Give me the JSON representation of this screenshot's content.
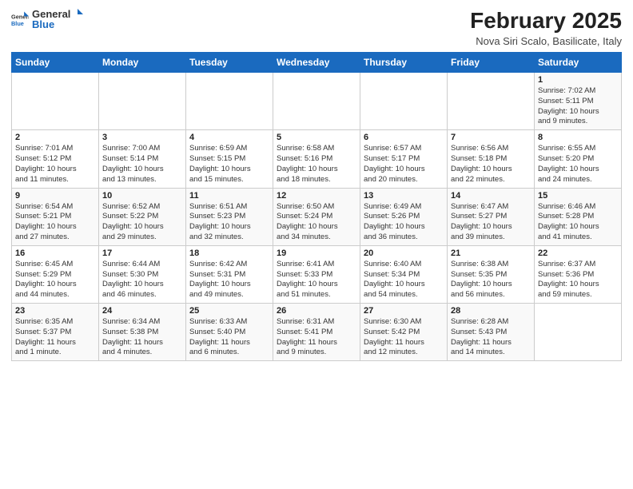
{
  "header": {
    "logo_general": "General",
    "logo_blue": "Blue",
    "title": "February 2025",
    "location": "Nova Siri Scalo, Basilicate, Italy"
  },
  "days_of_week": [
    "Sunday",
    "Monday",
    "Tuesday",
    "Wednesday",
    "Thursday",
    "Friday",
    "Saturday"
  ],
  "weeks": [
    [
      {
        "day": "",
        "info": ""
      },
      {
        "day": "",
        "info": ""
      },
      {
        "day": "",
        "info": ""
      },
      {
        "day": "",
        "info": ""
      },
      {
        "day": "",
        "info": ""
      },
      {
        "day": "",
        "info": ""
      },
      {
        "day": "1",
        "info": "Sunrise: 7:02 AM\nSunset: 5:11 PM\nDaylight: 10 hours\nand 9 minutes."
      }
    ],
    [
      {
        "day": "2",
        "info": "Sunrise: 7:01 AM\nSunset: 5:12 PM\nDaylight: 10 hours\nand 11 minutes."
      },
      {
        "day": "3",
        "info": "Sunrise: 7:00 AM\nSunset: 5:14 PM\nDaylight: 10 hours\nand 13 minutes."
      },
      {
        "day": "4",
        "info": "Sunrise: 6:59 AM\nSunset: 5:15 PM\nDaylight: 10 hours\nand 15 minutes."
      },
      {
        "day": "5",
        "info": "Sunrise: 6:58 AM\nSunset: 5:16 PM\nDaylight: 10 hours\nand 18 minutes."
      },
      {
        "day": "6",
        "info": "Sunrise: 6:57 AM\nSunset: 5:17 PM\nDaylight: 10 hours\nand 20 minutes."
      },
      {
        "day": "7",
        "info": "Sunrise: 6:56 AM\nSunset: 5:18 PM\nDaylight: 10 hours\nand 22 minutes."
      },
      {
        "day": "8",
        "info": "Sunrise: 6:55 AM\nSunset: 5:20 PM\nDaylight: 10 hours\nand 24 minutes."
      }
    ],
    [
      {
        "day": "9",
        "info": "Sunrise: 6:54 AM\nSunset: 5:21 PM\nDaylight: 10 hours\nand 27 minutes."
      },
      {
        "day": "10",
        "info": "Sunrise: 6:52 AM\nSunset: 5:22 PM\nDaylight: 10 hours\nand 29 minutes."
      },
      {
        "day": "11",
        "info": "Sunrise: 6:51 AM\nSunset: 5:23 PM\nDaylight: 10 hours\nand 32 minutes."
      },
      {
        "day": "12",
        "info": "Sunrise: 6:50 AM\nSunset: 5:24 PM\nDaylight: 10 hours\nand 34 minutes."
      },
      {
        "day": "13",
        "info": "Sunrise: 6:49 AM\nSunset: 5:26 PM\nDaylight: 10 hours\nand 36 minutes."
      },
      {
        "day": "14",
        "info": "Sunrise: 6:47 AM\nSunset: 5:27 PM\nDaylight: 10 hours\nand 39 minutes."
      },
      {
        "day": "15",
        "info": "Sunrise: 6:46 AM\nSunset: 5:28 PM\nDaylight: 10 hours\nand 41 minutes."
      }
    ],
    [
      {
        "day": "16",
        "info": "Sunrise: 6:45 AM\nSunset: 5:29 PM\nDaylight: 10 hours\nand 44 minutes."
      },
      {
        "day": "17",
        "info": "Sunrise: 6:44 AM\nSunset: 5:30 PM\nDaylight: 10 hours\nand 46 minutes."
      },
      {
        "day": "18",
        "info": "Sunrise: 6:42 AM\nSunset: 5:31 PM\nDaylight: 10 hours\nand 49 minutes."
      },
      {
        "day": "19",
        "info": "Sunrise: 6:41 AM\nSunset: 5:33 PM\nDaylight: 10 hours\nand 51 minutes."
      },
      {
        "day": "20",
        "info": "Sunrise: 6:40 AM\nSunset: 5:34 PM\nDaylight: 10 hours\nand 54 minutes."
      },
      {
        "day": "21",
        "info": "Sunrise: 6:38 AM\nSunset: 5:35 PM\nDaylight: 10 hours\nand 56 minutes."
      },
      {
        "day": "22",
        "info": "Sunrise: 6:37 AM\nSunset: 5:36 PM\nDaylight: 10 hours\nand 59 minutes."
      }
    ],
    [
      {
        "day": "23",
        "info": "Sunrise: 6:35 AM\nSunset: 5:37 PM\nDaylight: 11 hours\nand 1 minute."
      },
      {
        "day": "24",
        "info": "Sunrise: 6:34 AM\nSunset: 5:38 PM\nDaylight: 11 hours\nand 4 minutes."
      },
      {
        "day": "25",
        "info": "Sunrise: 6:33 AM\nSunset: 5:40 PM\nDaylight: 11 hours\nand 6 minutes."
      },
      {
        "day": "26",
        "info": "Sunrise: 6:31 AM\nSunset: 5:41 PM\nDaylight: 11 hours\nand 9 minutes."
      },
      {
        "day": "27",
        "info": "Sunrise: 6:30 AM\nSunset: 5:42 PM\nDaylight: 11 hours\nand 12 minutes."
      },
      {
        "day": "28",
        "info": "Sunrise: 6:28 AM\nSunset: 5:43 PM\nDaylight: 11 hours\nand 14 minutes."
      },
      {
        "day": "",
        "info": ""
      }
    ]
  ]
}
